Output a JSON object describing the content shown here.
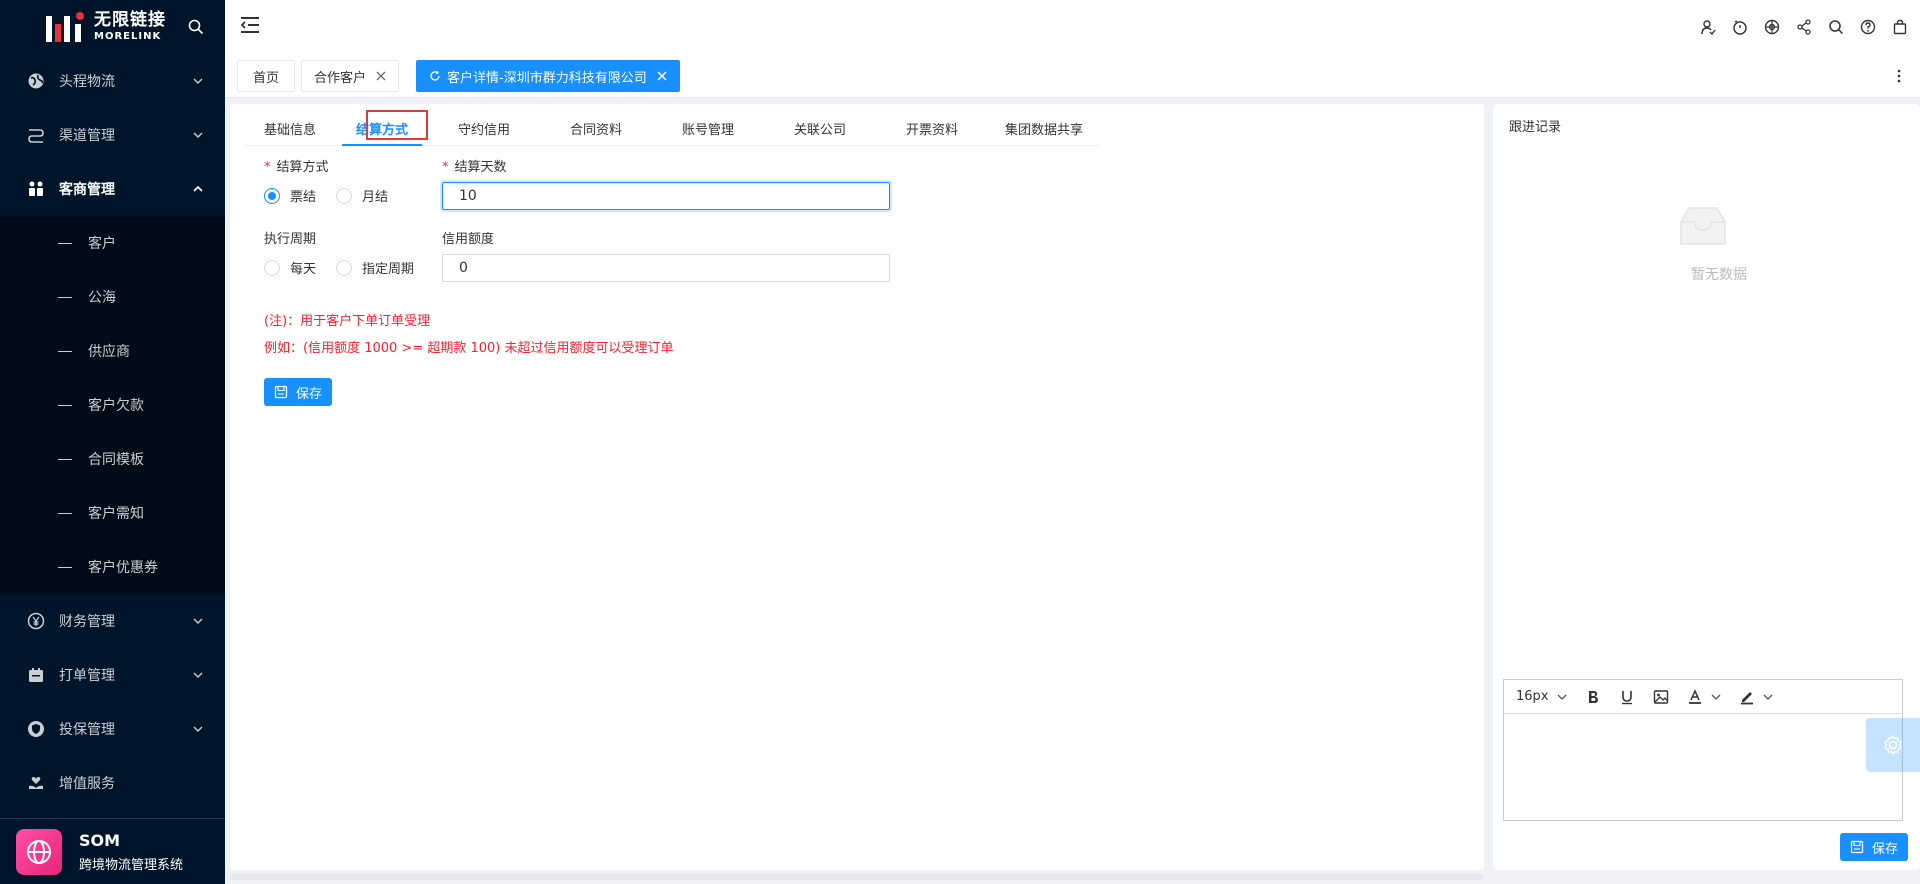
{
  "brand": {
    "name_cn": "无限链接",
    "name_en": "MORELINK"
  },
  "sidebar": {
    "items": [
      {
        "label": "头程物流",
        "icon": "globe-icon",
        "expanded": false
      },
      {
        "label": "渠道管理",
        "icon": "route-icon",
        "expanded": false
      },
      {
        "label": "客商管理",
        "icon": "people-icon",
        "expanded": true
      }
    ],
    "sub_items": [
      "客户",
      "公海",
      "供应商",
      "客户欠款",
      "合同模板",
      "客户需知",
      "客户优惠券"
    ],
    "items_after": [
      {
        "label": "财务管理",
        "icon": "yen-icon"
      },
      {
        "label": "打单管理",
        "icon": "print-icon"
      },
      {
        "label": "投保管理",
        "icon": "shield-icon"
      },
      {
        "label": "增值服务",
        "icon": "heart-hand-icon"
      }
    ],
    "system": {
      "name": "SOM",
      "desc": "跨境物流管理系统"
    }
  },
  "header": {
    "icons": [
      "user-switch-icon",
      "timer-icon",
      "globe-target-icon",
      "share-icon",
      "search-icon",
      "help-icon",
      "bag-icon"
    ]
  },
  "tabs": [
    {
      "label": "首页",
      "closable": false,
      "active": false
    },
    {
      "label": "合作客户",
      "closable": true,
      "active": false
    },
    {
      "label": "客户详情-深圳市群力科技有限公司",
      "closable": true,
      "active": true
    }
  ],
  "sub_tabs": [
    "基础信息",
    "结算方式",
    "守约信用",
    "合同资料",
    "账号管理",
    "关联公司",
    "开票资料",
    "集团数据共享"
  ],
  "active_sub_tab": "结算方式",
  "form": {
    "settle_label": "结算方式",
    "settle_options": [
      "票结",
      "月结"
    ],
    "settle_selected": "票结",
    "days_label": "结算天数",
    "days_value": "10",
    "cycle_label": "执行周期",
    "cycle_options": [
      "每天",
      "指定周期"
    ],
    "credit_label": "信用额度",
    "credit_value": "0",
    "note1": "(注)：用于客户下单订单受理",
    "note2": "例如：(信用额度 1000 >= 超期款 100) 未超过信用额度可以受理订单",
    "save_label": "保存"
  },
  "follow": {
    "title": "跟进记录",
    "empty_text": "暂无数据",
    "font_size": "16px",
    "save_label": "保存"
  },
  "colors": {
    "primary": "#1890ff",
    "sidebar_bg": "#001529",
    "danger": "#f5222d"
  }
}
